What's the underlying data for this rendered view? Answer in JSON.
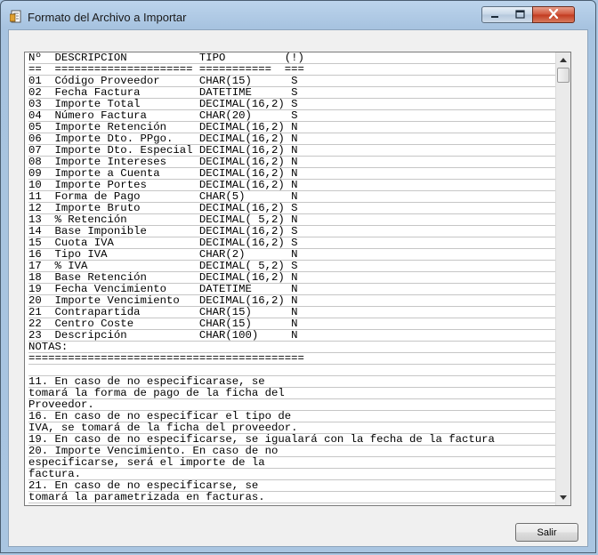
{
  "window": {
    "title": "Formato del Archivo a Importar"
  },
  "content": {
    "lines": [
      "Nº  DESCRIPCION           TIPO         (!)",
      "==  ===================== ===========  ===",
      "01  Código Proveedor      CHAR(15)      S",
      "02  Fecha Factura         DATETIME      S",
      "03  Importe Total         DECIMAL(16,2) S",
      "04  Número Factura        CHAR(20)      S",
      "05  Importe Retención     DECIMAL(16,2) N",
      "06  Importe Dto. PPgo.    DECIMAL(16,2) N",
      "07  Importe Dto. Especial DECIMAL(16,2) N",
      "08  Importe Intereses     DECIMAL(16,2) N",
      "09  Importe a Cuenta      DECIMAL(16,2) N",
      "10  Importe Portes        DECIMAL(16,2) N",
      "11  Forma de Pago         CHAR(5)       N",
      "12  Importe Bruto         DECIMAL(16,2) S",
      "13  % Retención           DECIMAL( 5,2) N",
      "14  Base Imponible        DECIMAL(16,2) S",
      "15  Cuota IVA             DECIMAL(16,2) S",
      "16  Tipo IVA              CHAR(2)       N",
      "17  % IVA                 DECIMAL( 5,2) S",
      "18  Base Retención        DECIMAL(16,2) N",
      "19  Fecha Vencimiento     DATETIME      N",
      "20  Importe Vencimiento   DECIMAL(16,2) N",
      "21  Contrapartida         CHAR(15)      N",
      "22  Centro Coste          CHAR(15)      N",
      "23  Descripción           CHAR(100)     N",
      "NOTAS:",
      "==========================================",
      "",
      "11. En caso de no especificarase, se",
      "tomará la forma de pago de la ficha del",
      "Proveedor.",
      "16. En caso de no especificar el tipo de",
      "IVA, se tomará de la ficha del proveedor.",
      "19. En caso de no especificarse, se igualará con la fecha de la factura",
      "20. Importe Vencimiento. En caso de no",
      "especificarse, será el importe de la",
      "factura.",
      "21. En caso de no especificarse, se",
      "tomará la parametrizada en facturas.",
      "",
      ""
    ]
  },
  "buttons": {
    "salir": "Salir"
  },
  "icons": {
    "app": "document-icon",
    "minimize": "minimize-icon",
    "maximize": "maximize-icon",
    "close": "close-icon",
    "scroll_up": "chevron-up-icon",
    "scroll_down": "chevron-down-icon"
  },
  "colors": {
    "close_button": "#c23a1f",
    "frame": "#a9c5e1"
  }
}
